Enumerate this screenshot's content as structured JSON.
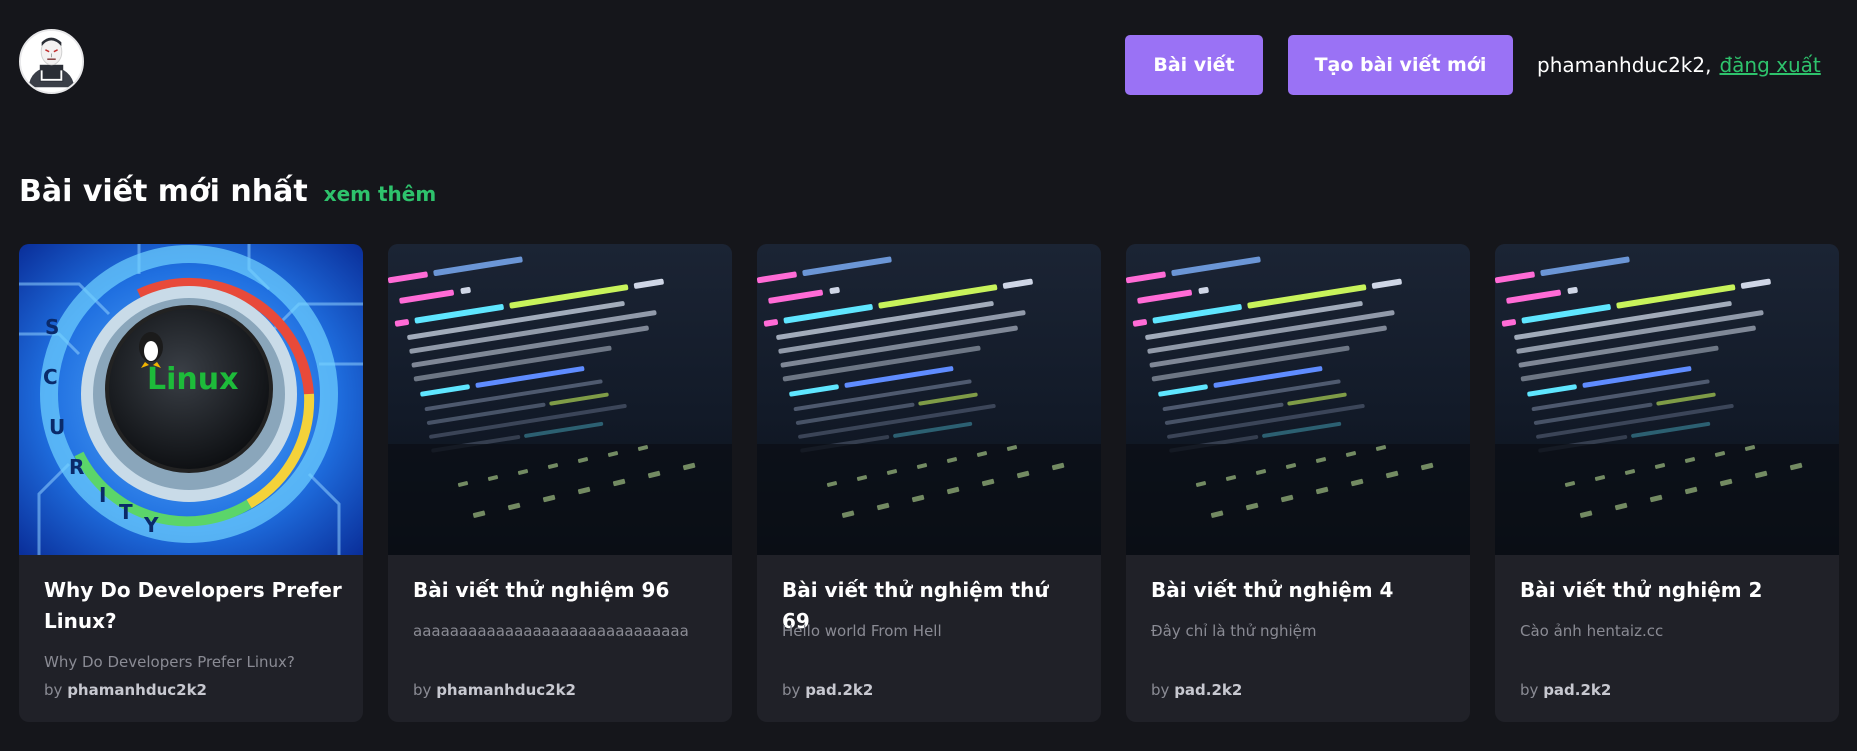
{
  "header": {
    "avatar_icon": "avatar-icon",
    "posts_button": "Bài viết",
    "create_button": "Tạo bài viết mới",
    "username": "phamanhduc2k2,",
    "logout_label": "đăng xuất"
  },
  "section": {
    "title": "Bài viết mới nhất",
    "see_more": "xem thêm"
  },
  "cards": [
    {
      "image": "linux-security-image",
      "title": "Why Do Developers Prefer Linux?",
      "description": "Why Do Developers Prefer Linux?",
      "by_label": "by",
      "author": "phamanhduc2k2"
    },
    {
      "image": "code-screen-image",
      "title": "Bài viết thử nghiệm 96",
      "description": "aaaaaaaaaaaaaaaaaaaaaaaaaaaaaa",
      "by_label": "by",
      "author": "phamanhduc2k2"
    },
    {
      "image": "code-screen-image",
      "title": "Bài viết thử nghiệm thứ 69",
      "description": "Hello world From Hell",
      "by_label": "by",
      "author": "pad.2k2"
    },
    {
      "image": "code-screen-image",
      "title": "Bài viết thử nghiệm 4",
      "description": "Đây chỉ là thử nghiệm",
      "by_label": "by",
      "author": "pad.2k2"
    },
    {
      "image": "code-screen-image",
      "title": "Bài viết thử nghiệm 2",
      "description": "Cào ảnh hentaiz.cc",
      "by_label": "by",
      "author": "pad.2k2"
    }
  ],
  "colors": {
    "background": "#15161b",
    "card": "#202128",
    "accent_purple": "#9a72f5",
    "accent_green": "#2ec26c"
  }
}
